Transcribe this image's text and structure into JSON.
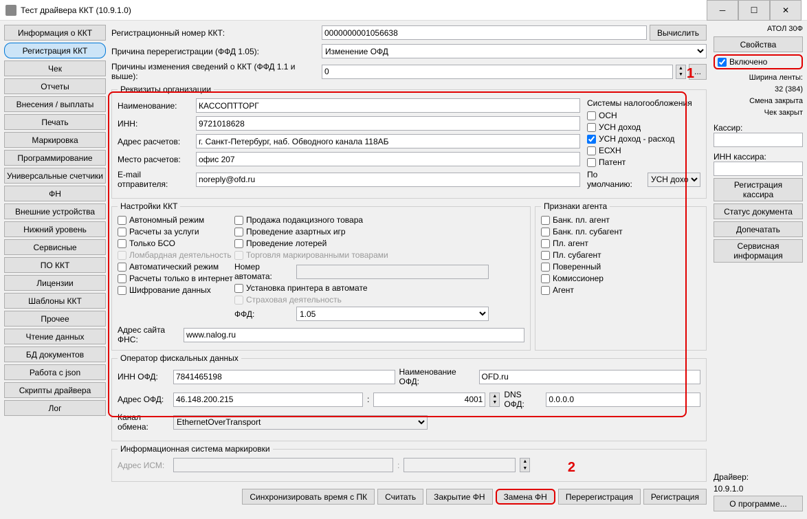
{
  "window_title": "Тест драйвера ККТ (10.9.1.0)",
  "sidebar": {
    "items": [
      {
        "label": "Информация о ККТ"
      },
      {
        "label": "Регистрация ККТ"
      },
      {
        "label": "Чек"
      },
      {
        "label": "Отчеты"
      },
      {
        "label": "Внесения / выплаты"
      },
      {
        "label": "Печать"
      },
      {
        "label": "Маркировка"
      },
      {
        "label": "Программирование"
      },
      {
        "label": "Универсальные счетчики"
      },
      {
        "label": "ФН"
      },
      {
        "label": "Внешние устройства"
      },
      {
        "label": "Нижний уровень"
      },
      {
        "label": "Сервисные"
      },
      {
        "label": "ПО ККТ"
      },
      {
        "label": "Лицензии"
      },
      {
        "label": "Шаблоны ККТ"
      },
      {
        "label": "Прочее"
      },
      {
        "label": "Чтение данных"
      },
      {
        "label": "БД документов"
      },
      {
        "label": "Работа с json"
      },
      {
        "label": "Скрипты драйвера"
      },
      {
        "label": "Лог"
      }
    ]
  },
  "top": {
    "reg_label": "Регистрационный номер ККТ:",
    "reg_value": "0000000001056638",
    "compute": "Вычислить",
    "reason_label": "Причина перерегистрации (ФФД 1.05):",
    "reason_value": "Изменение ОФД",
    "changes_label": "Причины изменения сведений о ККТ (ФФД 1.1 и выше):",
    "changes_value": "0",
    "ellipsis": "..."
  },
  "org": {
    "legend": "Реквизиты организации",
    "name_label": "Наименование:",
    "name_value": "КАССОПТТОРГ",
    "inn_label": "ИНН:",
    "inn_value": "9721018628",
    "addr_label": "Адрес расчетов:",
    "addr_value": "г. Санкт-Петербург, наб. Обводного канала 118АБ",
    "place_label": "Место расчетов:",
    "place_value": "офис 207",
    "email_label": "E-mail отправителя:",
    "email_value": "noreply@ofd.ru",
    "tax_legend": "Системы налогообложения",
    "tax": {
      "osn": "ОСН",
      "usn_income": "УСН доход",
      "usn_income_exp": "УСН доход - расход",
      "esxn": "ЕСХН",
      "patent": "Патент"
    },
    "default_label": "По умолчанию:",
    "default_value": "УСН дохо"
  },
  "kkt": {
    "legend": "Настройки ККТ",
    "c1": {
      "autonomous": "Автономный режим",
      "services": "Расчеты за услуги",
      "bso": "Только БСО",
      "lombard": "Ломбардная деятельность",
      "auto": "Автоматический режим",
      "internet": "Расчеты только в интернет",
      "encrypt": "Шифрование данных"
    },
    "c2": {
      "excise": "Продажа подакцизного товара",
      "gambling": "Проведение азартных игр",
      "lottery": "Проведение лотерей",
      "marked": "Торговля маркированными товарами",
      "automat_label": "Номер автомата:",
      "automat_value": "",
      "printer": "Установка принтера в автомате",
      "insurance": "Страховая деятельность",
      "ffd_label": "ФФД:",
      "ffd_value": "1.05"
    },
    "fns_label": "Адрес сайта ФНС:",
    "fns_value": "www.nalog.ru"
  },
  "agent": {
    "legend": "Признаки агента",
    "a1": "Банк. пл. агент",
    "a2": "Банк. пл. субагент",
    "a3": "Пл. агент",
    "a4": "Пл. субагент",
    "a5": "Поверенный",
    "a6": "Комиссионер",
    "a7": "Агент"
  },
  "ofd": {
    "legend": "Оператор фискальных данных",
    "inn_label": "ИНН ОФД:",
    "inn_value": "7841465198",
    "name_label": "Наименование ОФД:",
    "name_value": "OFD.ru",
    "addr_label": "Адрес ОФД:",
    "addr_value": "46.148.200.215",
    "port_value": "4001",
    "dns_label": "DNS ОФД:",
    "dns_value": "0.0.0.0",
    "channel_label": "Канал обмена:",
    "channel_value": "EthernetOverTransport"
  },
  "ism": {
    "legend": "Информационная система маркировки",
    "addr_label": "Адрес ИСМ:",
    "addr_value": "",
    "port_value": ""
  },
  "footer": {
    "sync": "Синхронизировать время с ПК",
    "read": "Считать",
    "close_fn": "Закрытие ФН",
    "replace_fn": "Замена ФН",
    "rereg": "Перерегистрация",
    "reg": "Регистрация"
  },
  "right": {
    "model": "АТОЛ 30Ф",
    "properties": "Свойства",
    "enabled": "Включено",
    "tape": "Ширина ленты:",
    "tape_val": "32 (384)",
    "shift": "Смена закрыта",
    "check": "Чек закрыт",
    "cashier_label": "Кассир:",
    "cashier_value": "",
    "cashier_inn_label": "ИНН кассира:",
    "cashier_inn_value": "",
    "reg_cashier": "Регистрация\nкассира",
    "doc_status": "Статус документа",
    "reprint": "Допечатать",
    "service": "Сервисная\nинформация",
    "driver_label": "Драйвер:",
    "driver_ver": "10.9.1.0",
    "about": "О программе..."
  },
  "annotations": {
    "one": "1",
    "two": "2"
  }
}
